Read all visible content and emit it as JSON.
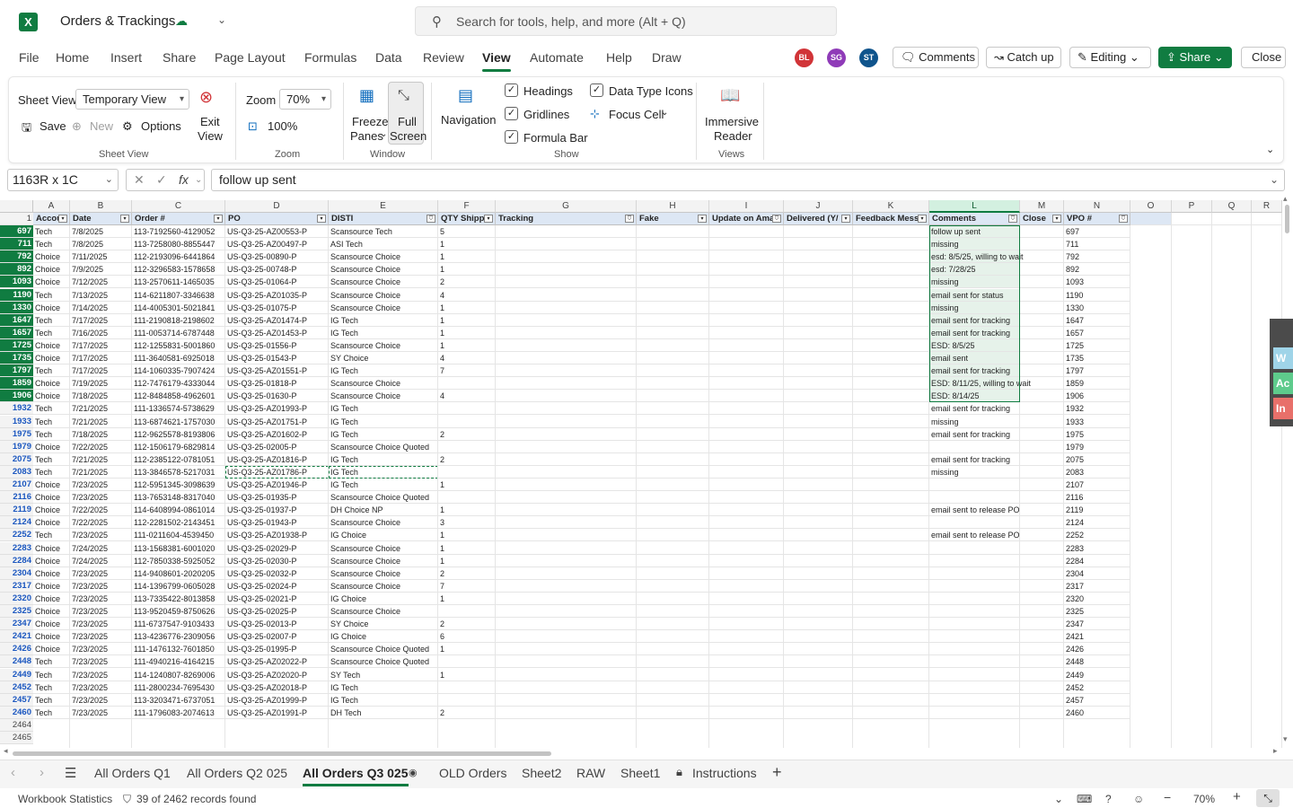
{
  "app": {
    "logo": "X",
    "doc_title": "Orders & Trackings",
    "search_placeholder": "Search for tools, help, and more (Alt + Q)"
  },
  "menu": {
    "items": [
      "File",
      "Home",
      "Insert",
      "Share",
      "Page Layout",
      "Formulas",
      "Data",
      "Review",
      "View",
      "Automate",
      "Help",
      "Draw"
    ],
    "active": "View",
    "avatars": [
      {
        "initials": "BL",
        "color": "#d13438"
      },
      {
        "initials": "SG",
        "color": "#8f3bb8"
      },
      {
        "initials": "ST",
        "color": "#0f548c"
      }
    ],
    "comments_label": "Comments",
    "catchup_label": "Catch up",
    "editing_label": "Editing",
    "share_label": "Share",
    "close_label": "Close"
  },
  "ribbon": {
    "sheet_view_label": "Sheet View",
    "sheet_view_value": "Temporary View",
    "exit_view_label1": "Exit",
    "exit_view_label2": "View",
    "save_label": "Save",
    "new_label": "New",
    "options_label": "Options",
    "group_sheet_view": "Sheet View",
    "zoom_label": "Zoom",
    "zoom_value": "70%",
    "zoom_100": "100%",
    "group_zoom": "Zoom",
    "freeze_label1": "Freeze",
    "freeze_label2": "Panes",
    "full_label1": "Full",
    "full_label2": "Screen",
    "group_window": "Window",
    "navigation_label": "Navigation",
    "headings_label": "Headings",
    "gridlines_label": "Gridlines",
    "formula_bar_label": "Formula Bar",
    "data_type_icons_label": "Data Type Icons",
    "focus_cell_label": "Focus Cell",
    "group_show": "Show",
    "immersive_label1": "Immersive",
    "immersive_label2": "Reader",
    "group_views": "Views"
  },
  "formula_bar": {
    "name_box": "1163R x 1C",
    "content": "follow up sent"
  },
  "grid": {
    "columns": [
      "A",
      "B",
      "C",
      "D",
      "E",
      "F",
      "G",
      "H",
      "I",
      "J",
      "K",
      "L",
      "M",
      "N",
      "O",
      "P",
      "Q",
      "R"
    ],
    "header_row_number": "1",
    "headers": [
      "Accou",
      "Date",
      "Order #",
      "PO",
      "DISTI",
      "QTY Shippe",
      "Tracking",
      "Fake",
      "Update on Ama",
      "Delivered (Y/",
      "Feedback Messa",
      "Comments",
      "Close",
      "VPO #"
    ],
    "rows": [
      {
        "n": "697",
        "a": "Tech",
        "b": "7/8/2025",
        "c": "113-7192560-4129052",
        "d": "US-Q3-25-AZ00553-P",
        "e": "Scansource Tech",
        "f": "5",
        "l": "follow up sent"
      },
      {
        "n": "711",
        "a": "Tech",
        "b": "7/8/2025",
        "c": "113-7258080-8855447",
        "d": "US-Q3-25-AZ00497-P",
        "e": "ASI Tech",
        "f": "1",
        "l": "missing"
      },
      {
        "n": "792",
        "a": "Choice",
        "b": "7/11/2025",
        "c": "112-2193096-6441864",
        "d": "US-Q3-25-00890-P",
        "e": "Scansource Choice",
        "f": "1",
        "l": "esd: 8/5/25, willing to wait"
      },
      {
        "n": "892",
        "a": "Choice",
        "b": "7/9/2025",
        "c": "112-3296583-1578658",
        "d": "US-Q3-25-00748-P",
        "e": "Scansource Choice",
        "f": "1",
        "l": "esd: 7/28/25"
      },
      {
        "n": "1093",
        "a": "Choice",
        "b": "7/12/2025",
        "c": "113-2570611-1465035",
        "d": "US-Q3-25-01064-P",
        "e": "Scansource Choice",
        "f": "2",
        "l": "missing"
      },
      {
        "n": "1190",
        "a": "Tech",
        "b": "7/13/2025",
        "c": "114-6211807-3346638",
        "d": "US-Q3-25-AZ01035-P",
        "e": "Scansource Choice",
        "f": "4",
        "l": "email sent for status"
      },
      {
        "n": "1330",
        "a": "Choice",
        "b": "7/14/2025",
        "c": "114-4005301-5021841",
        "d": "US-Q3-25-01075-P",
        "e": "Scansource Choice",
        "f": "1",
        "l": "missing"
      },
      {
        "n": "1647",
        "a": "Tech",
        "b": "7/17/2025",
        "c": "111-2190818-2198602",
        "d": "US-Q3-25-AZ01474-P",
        "e": "IG Tech",
        "f": "1",
        "l": "email sent for tracking"
      },
      {
        "n": "1657",
        "a": "Tech",
        "b": "7/16/2025",
        "c": "111-0053714-6787448",
        "d": "US-Q3-25-AZ01453-P",
        "e": "IG Tech",
        "f": "1",
        "l": "email sent for tracking"
      },
      {
        "n": "1725",
        "a": "Choice",
        "b": "7/17/2025",
        "c": "112-1255831-5001860",
        "d": "US-Q3-25-01556-P",
        "e": "Scansource Choice",
        "f": "1",
        "l": " ESD:  8/5/25"
      },
      {
        "n": "1735",
        "a": "Choice",
        "b": "7/17/2025",
        "c": "111-3640581-6925018",
        "d": "US-Q3-25-01543-P",
        "e": "SY Choice",
        "f": "4",
        "l": "email sent"
      },
      {
        "n": "1797",
        "a": "Tech",
        "b": "7/17/2025",
        "c": "114-1060335-7907424",
        "d": "US-Q3-25-AZ01551-P",
        "e": "IG Tech",
        "f": "7",
        "l": "email sent for tracking"
      },
      {
        "n": "1859",
        "a": "Choice",
        "b": "7/19/2025",
        "c": "112-7476179-4333044",
        "d": "US-Q3-25-01818-P",
        "e": "Scansource Choice",
        "f": "",
        "l": "ESD: 8/11/25, willing to wait"
      },
      {
        "n": "1906",
        "a": "Choice",
        "b": "7/18/2025",
        "c": "112-8484858-4962601",
        "d": "US-Q3-25-01630-P",
        "e": "Scansource Choice",
        "f": "4",
        "l": "ESD: 8/14/25"
      },
      {
        "n": "1932",
        "a": "Tech",
        "b": "7/21/2025",
        "c": "111-1336574-5738629",
        "d": "US-Q3-25-AZ01993-P",
        "e": "IG Tech",
        "f": "",
        "l": "email sent for tracking"
      },
      {
        "n": "1933",
        "a": "Tech",
        "b": "7/21/2025",
        "c": "113-6874621-1757030",
        "d": "US-Q3-25-AZ01751-P",
        "e": "IG Tech",
        "f": "",
        "l": "missing"
      },
      {
        "n": "1975",
        "a": "Tech",
        "b": "7/18/2025",
        "c": "112-9625578-8193806",
        "d": "US-Q3-25-AZ01602-P",
        "e": "IG Tech",
        "f": "2",
        "l": "email sent for tracking"
      },
      {
        "n": "1979",
        "a": "Choice",
        "b": "7/22/2025",
        "c": "112-1506179-6829814",
        "d": "US-Q3-25-02005-P",
        "e": "Scansource Choice Quoted",
        "f": "",
        "l": ""
      },
      {
        "n": "2075",
        "a": "Tech",
        "b": "7/21/2025",
        "c": "112-2385122-0781051",
        "d": "US-Q3-25-AZ01816-P",
        "e": "IG Tech",
        "f": "2",
        "l": "email sent for tracking"
      },
      {
        "n": "2083",
        "a": "Tech",
        "b": "7/21/2025",
        "c": "113-3846578-5217031",
        "d": "US-Q3-25-AZ01786-P",
        "e": "IG Tech",
        "f": "",
        "l": "missing"
      },
      {
        "n": "2107",
        "a": "Choice",
        "b": "7/23/2025",
        "c": "112-5951345-3098639",
        "d": "US-Q3-25-AZ01946-P",
        "e": "IG Tech",
        "f": "1",
        "l": ""
      },
      {
        "n": "2116",
        "a": "Choice",
        "b": "7/23/2025",
        "c": "113-7653148-8317040",
        "d": "US-Q3-25-01935-P",
        "e": "Scansource Choice Quoted",
        "f": "",
        "l": ""
      },
      {
        "n": "2119",
        "a": "Choice",
        "b": "7/22/2025",
        "c": "114-6408994-0861014",
        "d": "US-Q3-25-01937-P",
        "e": "DH Choice NP",
        "f": "1",
        "l": "email sent to release PO"
      },
      {
        "n": "2124",
        "a": "Choice",
        "b": "7/22/2025",
        "c": "112-2281502-2143451",
        "d": "US-Q3-25-01943-P",
        "e": "Scansource Choice",
        "f": "3",
        "l": ""
      },
      {
        "n": "2252",
        "a": "Tech",
        "b": "7/23/2025",
        "c": "111-0211604-4539450",
        "d": "US-Q3-25-AZ01938-P",
        "e": "IG Choice",
        "f": "1",
        "l": "email sent to release PO"
      },
      {
        "n": "2283",
        "a": "Choice",
        "b": "7/24/2025",
        "c": "113-1568381-6001020",
        "d": "US-Q3-25-02029-P",
        "e": "Scansource Choice",
        "f": "1",
        "l": ""
      },
      {
        "n": "2284",
        "a": "Choice",
        "b": "7/24/2025",
        "c": "112-7850338-5925052",
        "d": "US-Q3-25-02030-P",
        "e": "Scansource Choice",
        "f": "1",
        "l": ""
      },
      {
        "n": "2304",
        "a": "Choice",
        "b": "7/23/2025",
        "c": "114-9408601-2020205",
        "d": "US-Q3-25-02032-P",
        "e": "Scansource Choice",
        "f": "2",
        "l": ""
      },
      {
        "n": "2317",
        "a": "Choice",
        "b": "7/23/2025",
        "c": "114-1396799-0605028",
        "d": "US-Q3-25-02024-P",
        "e": "Scansource Choice",
        "f": "7",
        "l": ""
      },
      {
        "n": "2320",
        "a": "Choice",
        "b": "7/23/2025",
        "c": "113-7335422-8013858",
        "d": "US-Q3-25-02021-P",
        "e": "IG Choice",
        "f": "1",
        "l": ""
      },
      {
        "n": "2325",
        "a": "Choice",
        "b": "7/23/2025",
        "c": "113-9520459-8750626",
        "d": "US-Q3-25-02025-P",
        "e": "Scansource Choice",
        "f": "",
        "l": ""
      },
      {
        "n": "2347",
        "a": "Choice",
        "b": "7/23/2025",
        "c": "111-6737547-9103433",
        "d": "US-Q3-25-02013-P",
        "e": "SY Choice",
        "f": "2",
        "l": ""
      },
      {
        "n": "2421",
        "a": "Choice",
        "b": "7/23/2025",
        "c": "113-4236776-2309056",
        "d": "US-Q3-25-02007-P",
        "e": "IG Choice",
        "f": "6",
        "l": ""
      },
      {
        "n": "2426",
        "a": "Choice",
        "b": "7/23/2025",
        "c": "111-1476132-7601850",
        "d": "US-Q3-25-01995-P",
        "e": "Scansource Choice Quoted",
        "f": "1",
        "l": ""
      },
      {
        "n": "2448",
        "a": "Tech",
        "b": "7/23/2025",
        "c": "111-4940216-4164215",
        "d": "US-Q3-25-AZ02022-P",
        "e": "Scansource Choice Quoted",
        "f": "",
        "l": ""
      },
      {
        "n": "2449",
        "a": "Tech",
        "b": "7/23/2025",
        "c": "114-1240807-8269006",
        "d": "US-Q3-25-AZ02020-P",
        "e": "SY Tech",
        "f": "1",
        "l": ""
      },
      {
        "n": "2452",
        "a": "Tech",
        "b": "7/23/2025",
        "c": "111-2800234-7695430",
        "d": "US-Q3-25-AZ02018-P",
        "e": "IG Tech",
        "f": "",
        "l": ""
      },
      {
        "n": "2457",
        "a": "Tech",
        "b": "7/23/2025",
        "c": "113-3203471-6737051",
        "d": "US-Q3-25-AZ01999-P",
        "e": "IG Tech",
        "f": "",
        "l": ""
      },
      {
        "n": "2460",
        "a": "Tech",
        "b": "7/23/2025",
        "c": "111-1796083-2074613",
        "d": "US-Q3-25-AZ01991-P",
        "e": "DH Tech",
        "f": "2",
        "l": ""
      }
    ],
    "empty_rows": [
      "2464",
      "2465"
    ]
  },
  "sheet_tabs": {
    "tabs": [
      "All Orders Q1",
      "All Orders Q2 025",
      "All Orders Q3 025",
      "OLD Orders",
      "Sheet2",
      "RAW",
      "Sheet1",
      "Instructions"
    ],
    "active": "All Orders Q3 025"
  },
  "status": {
    "workbook_stats": "Workbook Statistics",
    "records": "39 of 2462 records found",
    "zoom": "70%"
  },
  "side_panel": [
    "W",
    "Ac",
    "In"
  ]
}
